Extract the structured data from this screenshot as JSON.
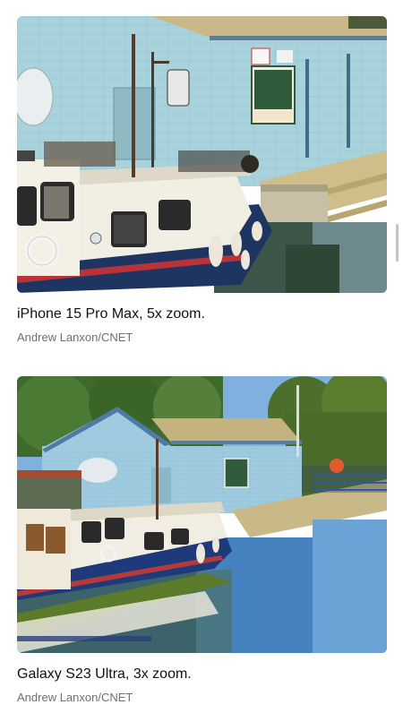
{
  "figures": [
    {
      "caption": "iPhone 15 Pro Max, 5x zoom.",
      "credit": "Andrew Lanxon/CNET",
      "image_alt": "Close-up of a white and blue narrowboat moored beside a pale blue brick boathouse"
    },
    {
      "caption": "Galaxy S23 Ultra, 3x zoom.",
      "credit": "Andrew Lanxon/CNET",
      "image_alt": "Wider view of the narrowboat and boathouse with trees, blue sky and reflections in the canal"
    }
  ]
}
